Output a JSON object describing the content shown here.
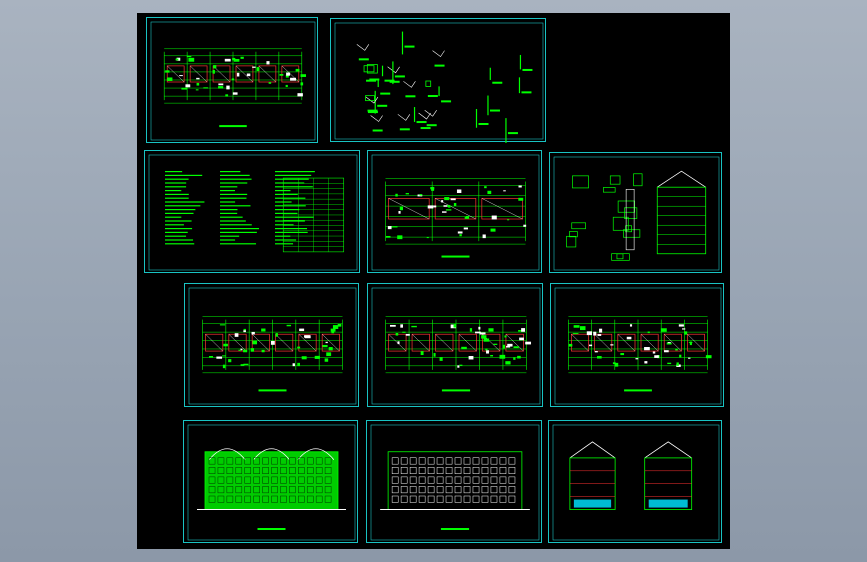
{
  "window": {
    "title": "",
    "background_color": "#9aa5b4",
    "canvas_color": "#000000",
    "frame_color": "#19c3c3",
    "line_color_primary": "#00ff00",
    "line_color_accent": "#ff3333",
    "line_color_secondary": "#ffffff"
  },
  "sheets": [
    {
      "name": "sheet-floor-plan-roof",
      "kind": "plan"
    },
    {
      "name": "sheet-details",
      "kind": "details"
    },
    {
      "name": "sheet-notes",
      "kind": "notes"
    },
    {
      "name": "sheet-plan-1",
      "kind": "plan2"
    },
    {
      "name": "sheet-section-details",
      "kind": "section"
    },
    {
      "name": "sheet-plan-2",
      "kind": "plan3"
    },
    {
      "name": "sheet-plan-3",
      "kind": "plan3"
    },
    {
      "name": "sheet-plan-4",
      "kind": "plan3"
    },
    {
      "name": "sheet-elevation-front",
      "kind": "elev1"
    },
    {
      "name": "sheet-elevation-rear",
      "kind": "elev2"
    },
    {
      "name": "sheet-elevation-side",
      "kind": "elev3"
    }
  ]
}
